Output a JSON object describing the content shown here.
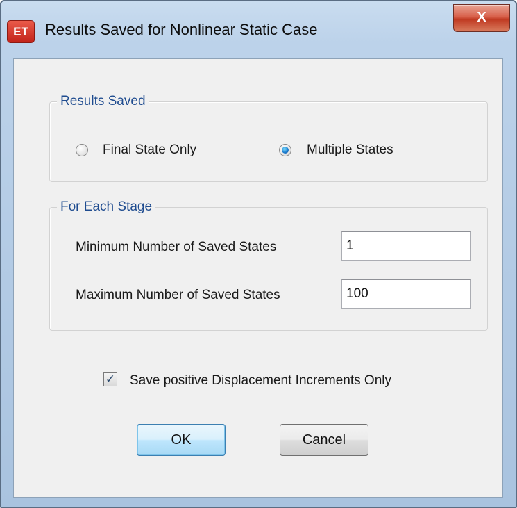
{
  "window": {
    "app_icon": "ET",
    "title": "Results Saved for Nonlinear Static Case",
    "close_label": "X"
  },
  "results_saved": {
    "group_label": "Results Saved",
    "options": [
      {
        "label": "Final State Only",
        "selected": false
      },
      {
        "label": "Multiple States",
        "selected": true
      }
    ]
  },
  "for_each_stage": {
    "group_label": "For Each Stage",
    "min_label": "Minimum Number of Saved States",
    "min_value": "1",
    "max_label": "Maximum Number of Saved States",
    "max_value": "100"
  },
  "save_positive": {
    "label": "Save positive Displacement Increments Only",
    "checked": true
  },
  "buttons": {
    "ok": "OK",
    "cancel": "Cancel"
  },
  "colors": {
    "group_label": "#1e4b8f",
    "close_button": "#c03a22",
    "radio_selected": "#1f7fd0"
  }
}
